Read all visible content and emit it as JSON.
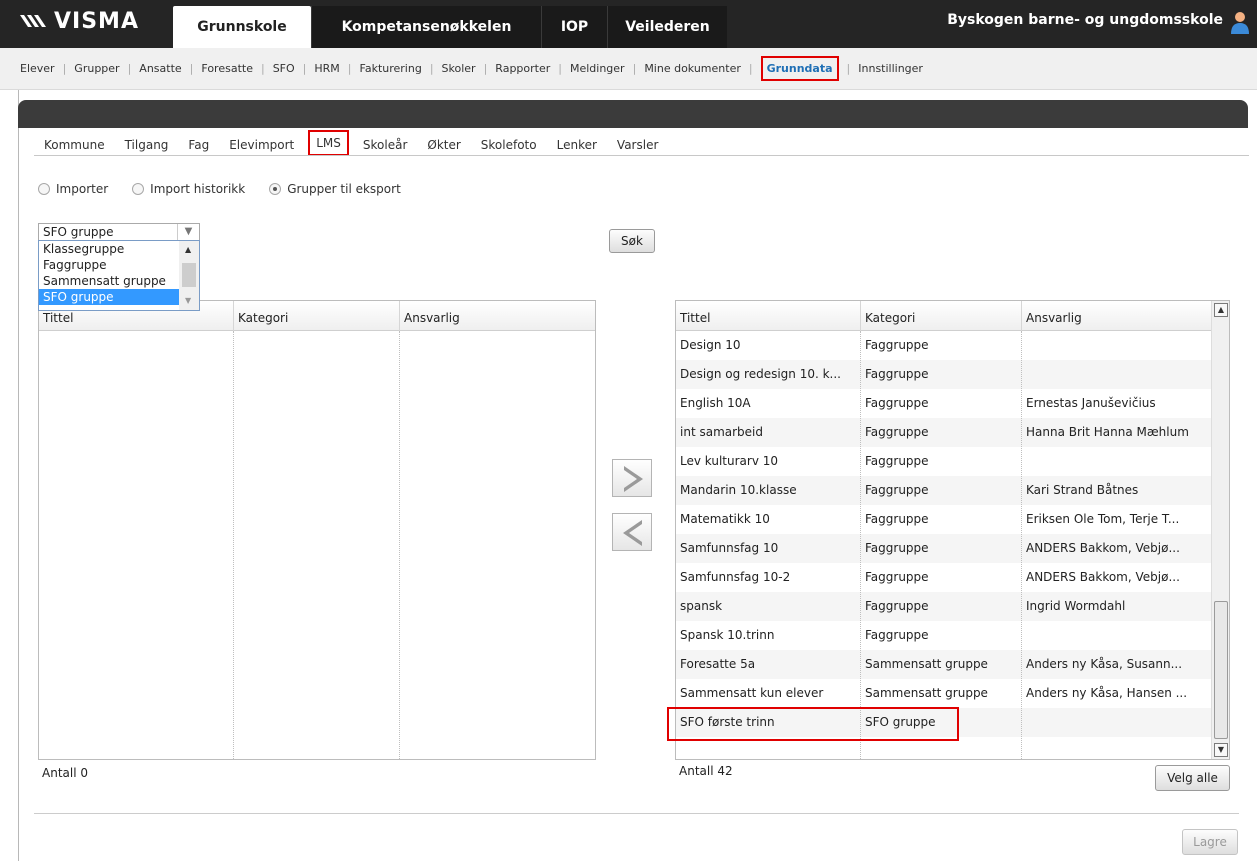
{
  "brand": "VISMA",
  "main_tabs": [
    {
      "label": "Grunnskole"
    },
    {
      "label": "Kompetansenøkkelen"
    },
    {
      "label": "IOP"
    },
    {
      "label": "Veilederen"
    }
  ],
  "school_name": "Byskogen barne- og ungdomsskole",
  "subnav": [
    {
      "label": "Elever"
    },
    {
      "label": "Grupper"
    },
    {
      "label": "Ansatte"
    },
    {
      "label": "Foresatte"
    },
    {
      "label": "SFO"
    },
    {
      "label": "HRM"
    },
    {
      "label": "Fakturering"
    },
    {
      "label": "Skoler"
    },
    {
      "label": "Rapporter"
    },
    {
      "label": "Meldinger"
    },
    {
      "label": "Mine dokumenter"
    },
    {
      "label": "Grunndata"
    },
    {
      "label": "Innstillinger"
    }
  ],
  "sub_tabs": [
    {
      "label": "Kommune"
    },
    {
      "label": "Tilgang"
    },
    {
      "label": "Fag"
    },
    {
      "label": "Elevimport"
    },
    {
      "label": "LMS"
    },
    {
      "label": "Skoleår"
    },
    {
      "label": "Økter"
    },
    {
      "label": "Skolefoto"
    },
    {
      "label": "Lenker"
    },
    {
      "label": "Varsler"
    }
  ],
  "radios": [
    {
      "label": "Importer",
      "checked": false
    },
    {
      "label": "Import historikk",
      "checked": false
    },
    {
      "label": "Grupper til eksport",
      "checked": true
    }
  ],
  "group_select": {
    "value": "SFO gruppe",
    "options": [
      "Klassegruppe",
      "Faggruppe",
      "Sammensatt gruppe",
      "SFO gruppe"
    ]
  },
  "search_button": "Søk",
  "left_grid": {
    "columns": [
      "Tittel",
      "Kategori",
      "Ansvarlig"
    ],
    "count_label": "Antall 0"
  },
  "right_grid": {
    "columns": [
      "Tittel",
      "Kategori",
      "Ansvarlig"
    ],
    "rows": [
      [
        "Design 10",
        "Faggruppe",
        ""
      ],
      [
        "Design og redesign 10. k...",
        "Faggruppe",
        ""
      ],
      [
        "English 10A",
        "Faggruppe",
        "Ernestas Januševičius"
      ],
      [
        "int samarbeid",
        "Faggruppe",
        "Hanna Brit Hanna Mæhlum"
      ],
      [
        "Lev kulturarv 10",
        "Faggruppe",
        ""
      ],
      [
        "Mandarin 10.klasse",
        "Faggruppe",
        "Kari Strand Båtnes"
      ],
      [
        "Matematikk 10",
        "Faggruppe",
        "Eriksen Ole Tom, Terje T..."
      ],
      [
        "Samfunnsfag 10",
        "Faggruppe",
        "ANDERS Bakkom, Vebjø..."
      ],
      [
        "Samfunnsfag 10-2",
        "Faggruppe",
        "ANDERS Bakkom, Vebjø..."
      ],
      [
        "spansk",
        "Faggruppe",
        "Ingrid Wormdahl"
      ],
      [
        "Spansk 10.trinn",
        "Faggruppe",
        ""
      ],
      [
        "Foresatte 5a",
        "Sammensatt gruppe",
        "Anders ny Kåsa, Susann..."
      ],
      [
        "Sammensatt kun elever",
        "Sammensatt gruppe",
        "Anders ny Kåsa, Hansen ..."
      ],
      [
        "SFO første trinn",
        "SFO gruppe",
        ""
      ]
    ],
    "count_label": "Antall 42"
  },
  "select_all_button": "Velg alle",
  "save_button": "Lagre",
  "colors": {
    "topbar": "#252525",
    "highlight": "#e00000",
    "active_link": "#1f6fb5",
    "selection": "#3399ff"
  },
  "icons": {
    "move_right": "arrow-right-icon",
    "move_left": "arrow-left-icon",
    "user": "user-icon"
  }
}
